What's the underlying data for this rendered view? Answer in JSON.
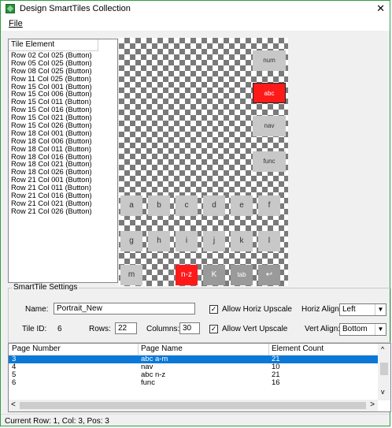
{
  "window": {
    "title": "Design SmartTiles Collection",
    "close": "✕"
  },
  "menu": {
    "file": "File"
  },
  "tile_list": {
    "header": "Tile Element",
    "items": [
      "Row 02 Col 025 (Button)",
      "Row 05 Col 025 (Button)",
      "Row 08 Col 025 (Button)",
      "Row 11 Col 025 (Button)",
      "Row 15 Col 001 (Button)",
      "Row 15 Col 006 (Button)",
      "Row 15 Col 011 (Button)",
      "Row 15 Col 016 (Button)",
      "Row 15 Col 021 (Button)",
      "Row 15 Col 026 (Button)",
      "Row 18 Col 001 (Button)",
      "Row 18 Col 006 (Button)",
      "Row 18 Col 011 (Button)",
      "Row 18 Col 016 (Button)",
      "Row 18 Col 021 (Button)",
      "Row 18 Col 026 (Button)",
      "Row 21 Col 001 (Button)",
      "Row 21 Col 011 (Button)",
      "Row 21 Col 016 (Button)",
      "Row 21 Col 021 (Button)",
      "Row 21 Col 026 (Button)"
    ]
  },
  "tiles": {
    "num": "num",
    "abc": "abc",
    "nav": "nav",
    "func": "func",
    "a": "a",
    "b": "b",
    "c": "c",
    "d": "d",
    "e": "e",
    "f": "f",
    "g": "g",
    "h": "h",
    "i": "i",
    "j": "j",
    "k": "k",
    "l": "l",
    "m": "m",
    "nz": "n-z",
    "first": "K",
    "tab": "tab",
    "enter": "↩"
  },
  "settings": {
    "group_label": "SmartTile Settings",
    "name_label": "Name:",
    "name_value": "Portrait_New",
    "tile_id_label": "Tile ID:",
    "tile_id_value": "6",
    "rows_label": "Rows:",
    "rows_value": "22",
    "columns_label": "Columns:",
    "columns_value": "30",
    "allow_horiz": "Allow Horiz Upscale",
    "allow_vert": "Allow Vert Upscale",
    "horiz_align_label": "Horiz Align:",
    "horiz_align_value": "Left",
    "vert_align_label": "Vert Align:",
    "vert_align_value": "Bottom",
    "checkmark": "✓"
  },
  "pages_table": {
    "headers": [
      "Page Number",
      "Page Name",
      "Element Count"
    ],
    "rows": [
      {
        "num": "3",
        "name": "abc a-m",
        "count": "21"
      },
      {
        "num": "4",
        "name": "nav",
        "count": "10"
      },
      {
        "num": "5",
        "name": "abc n-z",
        "count": "21"
      },
      {
        "num": "6",
        "name": "func",
        "count": "16"
      }
    ],
    "scroll_up": "^",
    "scroll_down": "v",
    "scroll_left": "<",
    "scroll_right": ">"
  },
  "status": "Current Row: 1, Col: 3, Pos: 3",
  "colors": {
    "accent": "#0a78d7",
    "selected_tile": "#ff1a1a",
    "window_border": "#2e9e44"
  }
}
